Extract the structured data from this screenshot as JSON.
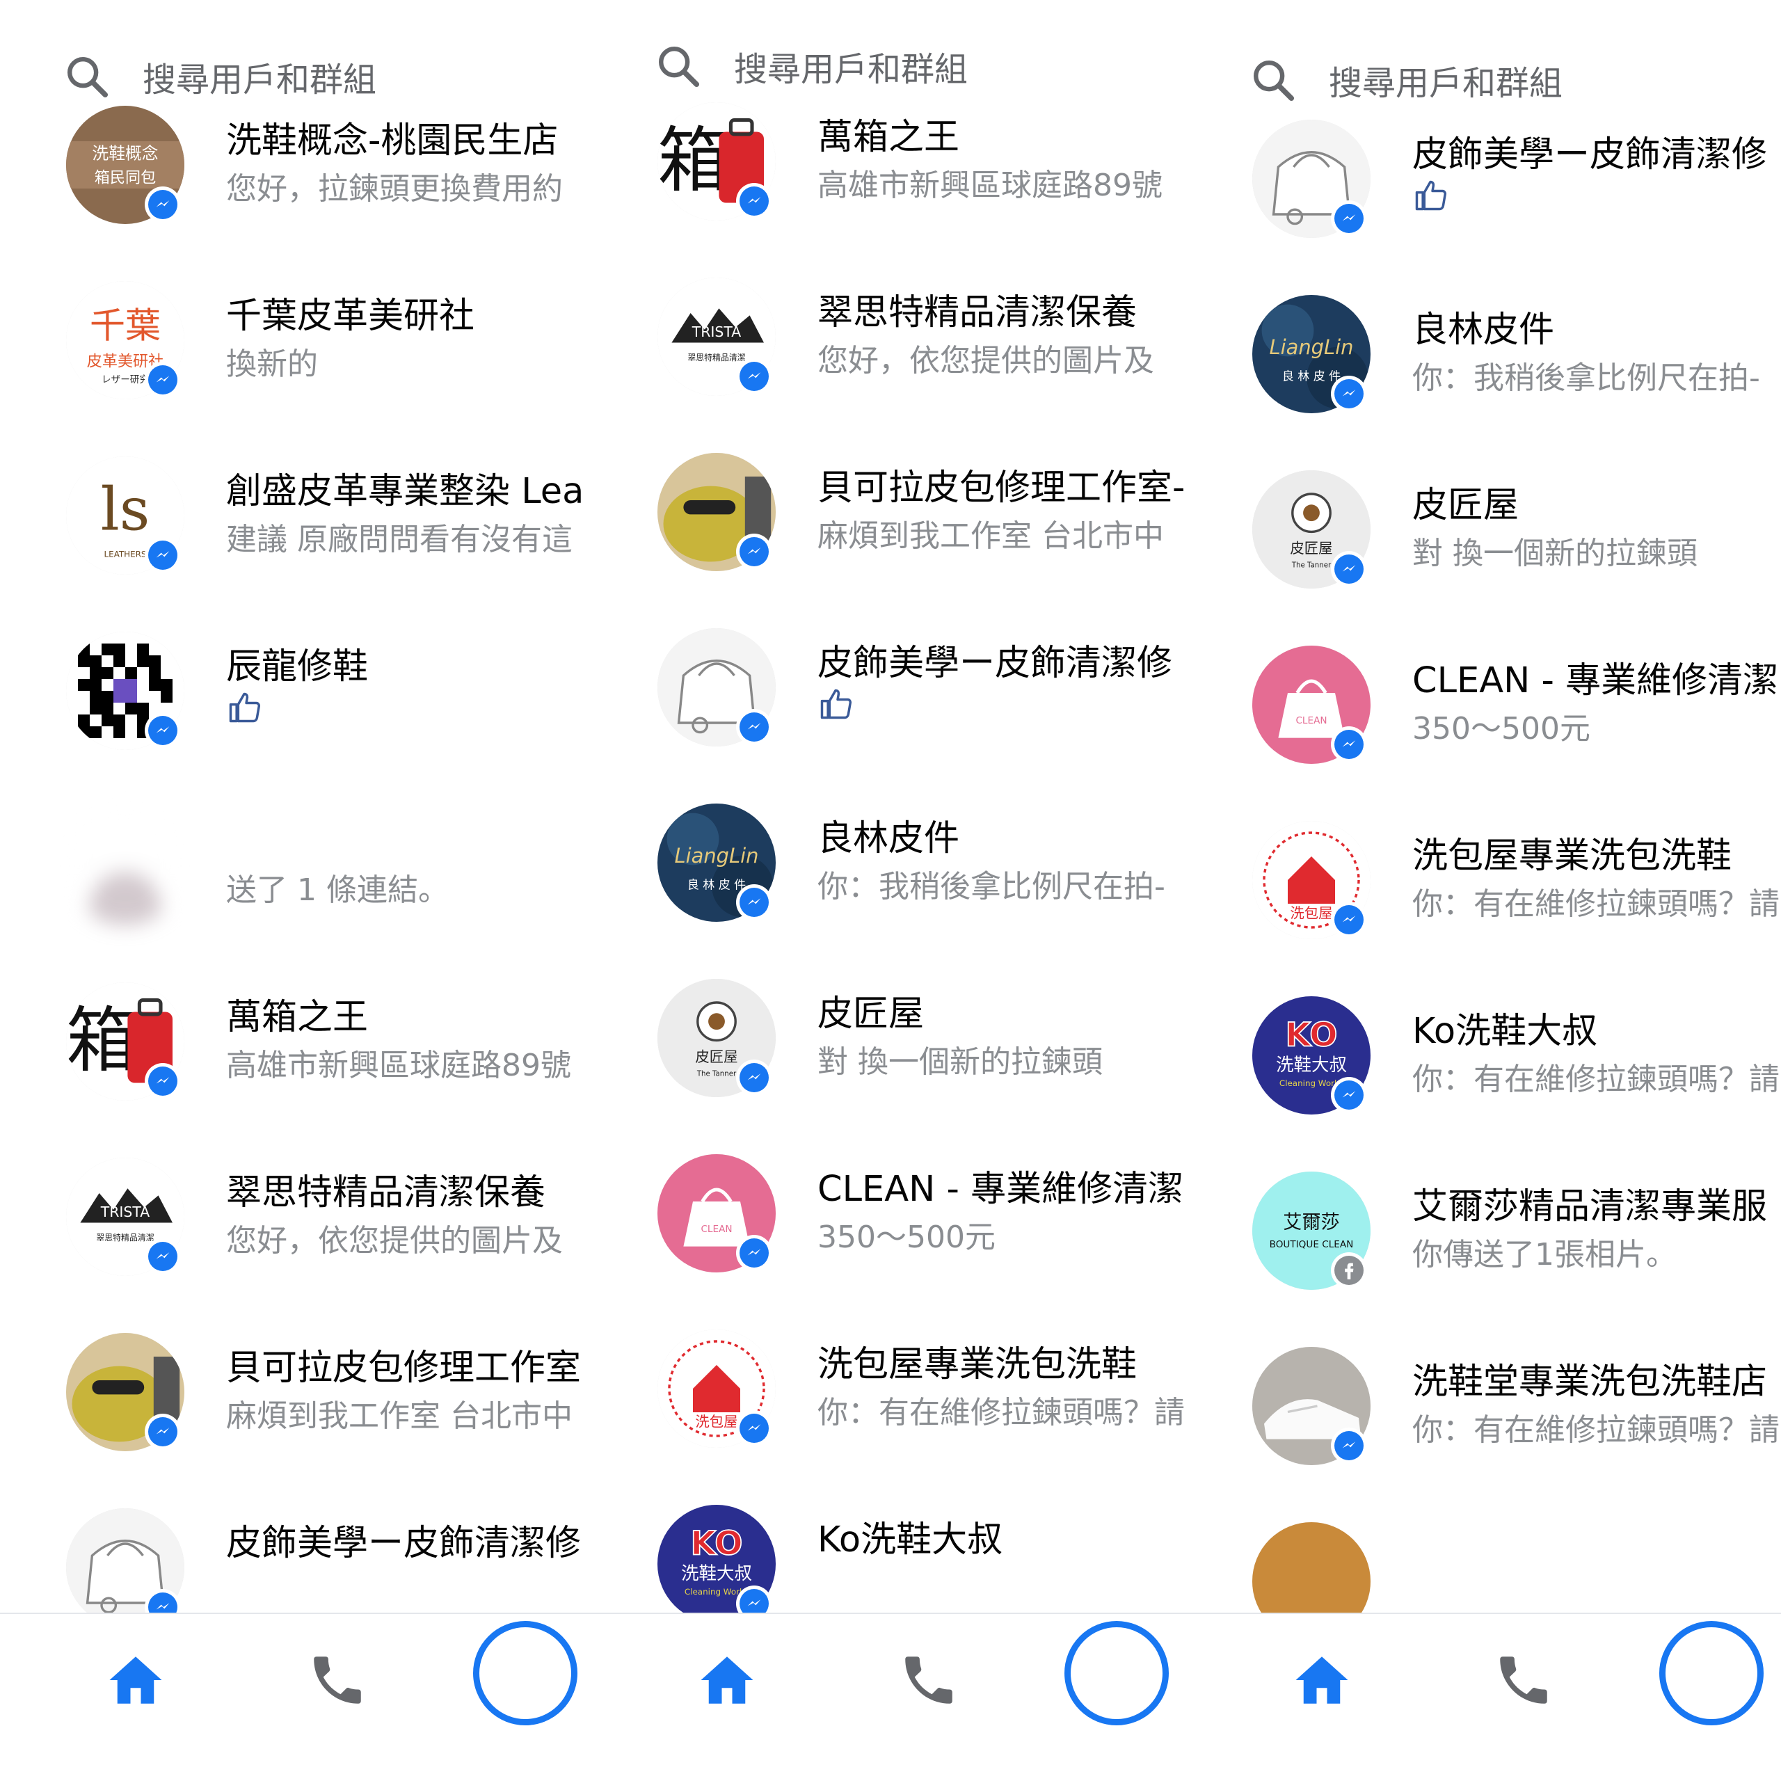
{
  "colors": {
    "accent": "#1877f2",
    "secondary_text": "#8a8d91",
    "primary_text": "#050505"
  },
  "panels": [
    {
      "search_placeholder": "搜尋用戶和群組",
      "rows": [
        {
          "name": "洗鞋概念-桃園民生店",
          "preview": "您好，拉鍊頭更換費用約",
          "avatar": "shoe-wash-concept-logo"
        },
        {
          "name": "千葉皮革美研社",
          "preview": "換新的",
          "avatar": "chiba-leather-logo"
        },
        {
          "name": "創盛皮革專業整染 Lea",
          "preview": "建議 原廠問問看有沒有這",
          "avatar": "ls-leathers-logo"
        },
        {
          "name": "辰龍修鞋",
          "preview": "",
          "avatar": "qr-code-logo",
          "like": true
        },
        {
          "name": "",
          "preview": "送了 1 條連結。",
          "avatar": "blurred-avatar",
          "blurred": true
        },
        {
          "name": "萬箱之王",
          "preview": "高雄市新興區球庭路89號",
          "avatar": "suitcase-king-logo"
        },
        {
          "name": "翠思特精品清潔保養",
          "preview": "您好，依您提供的圖片及",
          "avatar": "trista-logo"
        },
        {
          "name": "貝可拉皮包修理工作室",
          "preview": "麻煩到我工作室 台北市中",
          "avatar": "frog-logo"
        },
        {
          "name": "皮飾美學ー皮飾清潔修",
          "preview": "",
          "avatar": "bag-sketch-logo"
        }
      ]
    },
    {
      "search_placeholder": "搜尋用戶和群組",
      "rows": [
        {
          "name": "萬箱之王",
          "preview": "高雄市新興區球庭路89號",
          "avatar": "suitcase-king-logo"
        },
        {
          "name": "翠思特精品清潔保養",
          "preview": "您好，依您提供的圖片及",
          "avatar": "trista-logo"
        },
        {
          "name": "貝可拉皮包修理工作室-",
          "preview": "麻煩到我工作室 台北市中",
          "avatar": "frog-logo"
        },
        {
          "name": "皮飾美學ー皮飾清潔修",
          "preview": "",
          "avatar": "bag-sketch-logo",
          "like": true
        },
        {
          "name": "良林皮件",
          "preview": "你：我稍後拿比例尺在拍-",
          "avatar": "lianglin-logo"
        },
        {
          "name": "皮匠屋",
          "preview": "對 換一個新的拉鍊頭",
          "avatar": "tanner-logo"
        },
        {
          "name": "CLEAN - 專業維修清潔",
          "preview": "350～500元",
          "avatar": "clean-logo"
        },
        {
          "name": "洗包屋專業洗包洗鞋",
          "preview": "你：有在維修拉鍊頭嗎？請",
          "avatar": "bag-house-logo"
        },
        {
          "name": "Ko洗鞋大叔",
          "preview": "",
          "avatar": "ko-logo"
        }
      ]
    },
    {
      "search_placeholder": "搜尋用戶和群組",
      "rows": [
        {
          "name": "皮飾美學ー皮飾清潔修",
          "preview": "",
          "avatar": "bag-sketch-logo",
          "like": true
        },
        {
          "name": "良林皮件",
          "preview": "你：我稍後拿比例尺在拍-",
          "avatar": "lianglin-logo"
        },
        {
          "name": "皮匠屋",
          "preview": "對 換一個新的拉鍊頭",
          "avatar": "tanner-logo"
        },
        {
          "name": "CLEAN - 專業維修清潔",
          "preview": "350～500元",
          "avatar": "clean-logo"
        },
        {
          "name": "洗包屋專業洗包洗鞋",
          "preview": "你：有在維修拉鍊頭嗎？請",
          "avatar": "bag-house-logo"
        },
        {
          "name": "Ko洗鞋大叔",
          "preview": "你：有在維修拉鍊頭嗎？請",
          "avatar": "ko-logo"
        },
        {
          "name": "艾爾莎精品清潔專業服",
          "preview": "你傳送了1張相片。",
          "avatar": "elsa-logo",
          "badge": "facebook"
        },
        {
          "name": "洗鞋堂專業洗包洗鞋店",
          "preview": "你：有在維修拉鍊頭嗎？請",
          "avatar": "sneaker-photo"
        },
        {
          "name": "",
          "preview": "",
          "avatar": "partial-avatar"
        }
      ]
    }
  ],
  "nav": {
    "home_icon": "home-icon",
    "call_icon": "phone-icon",
    "active_color": "#1877f2",
    "inactive_color": "#65676b"
  }
}
